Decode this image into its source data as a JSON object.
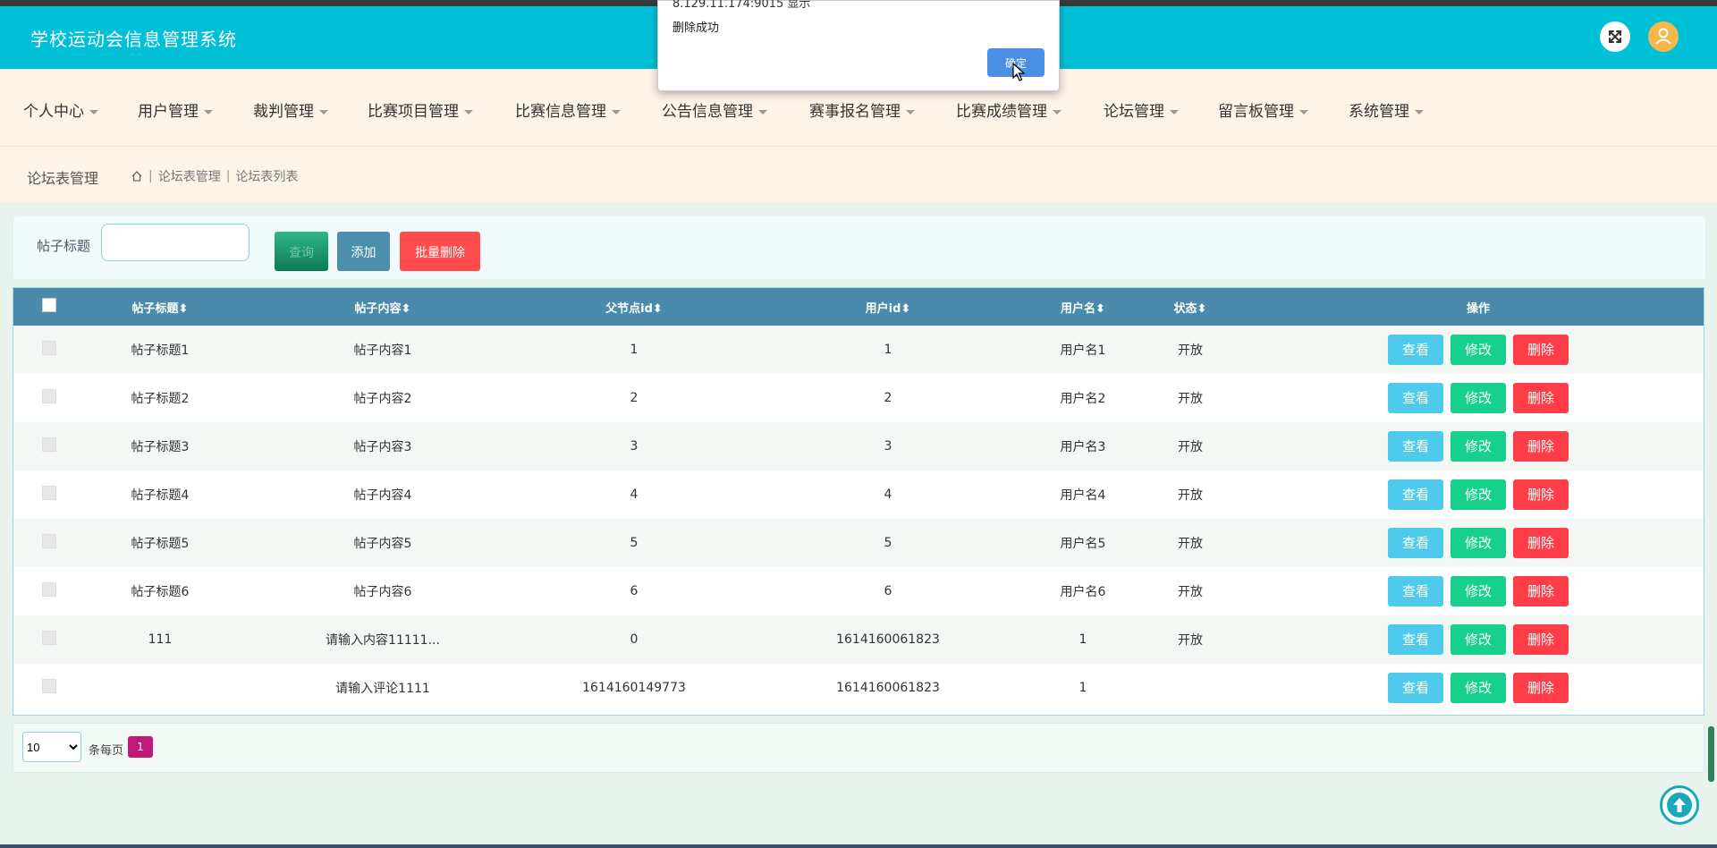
{
  "header": {
    "title": "学校运动会信息管理系统"
  },
  "nav": {
    "items": [
      "个人中心",
      "用户管理",
      "裁判管理",
      "比赛项目管理",
      "比赛信息管理",
      "公告信息管理",
      "赛事报名管理",
      "比赛成绩管理",
      "论坛管理",
      "留言板管理",
      "系统管理"
    ]
  },
  "breadcrumb": {
    "page": "论坛表管理",
    "level1": "论坛表管理",
    "level2": "论坛表列表"
  },
  "search": {
    "label": "帖子标题",
    "value": "",
    "search_btn": "查询",
    "add_btn": "添加",
    "batch_delete_btn": "批量删除"
  },
  "table": {
    "headers": [
      "帖子标题",
      "帖子内容",
      "父节点id",
      "用户id",
      "用户名",
      "状态",
      "操作"
    ],
    "actions": {
      "view": "查看",
      "edit": "修改",
      "delete": "删除"
    },
    "rows": [
      [
        "帖子标题1",
        "帖子内容1",
        "1",
        "1",
        "用户名1",
        "开放"
      ],
      [
        "帖子标题2",
        "帖子内容2",
        "2",
        "2",
        "用户名2",
        "开放"
      ],
      [
        "帖子标题3",
        "帖子内容3",
        "3",
        "3",
        "用户名3",
        "开放"
      ],
      [
        "帖子标题4",
        "帖子内容4",
        "4",
        "4",
        "用户名4",
        "开放"
      ],
      [
        "帖子标题5",
        "帖子内容5",
        "5",
        "5",
        "用户名5",
        "开放"
      ],
      [
        "帖子标题6",
        "帖子内容6",
        "6",
        "6",
        "用户名6",
        "开放"
      ],
      [
        "111",
        "请输入内容11111...",
        "0",
        "1614160061823",
        "1",
        "开放"
      ],
      [
        "",
        "请输入评论1111",
        "1614160149773",
        "1614160061823",
        "1",
        ""
      ]
    ]
  },
  "pagination": {
    "page_size": "10",
    "per_page_label": "条每页",
    "current_page": "1"
  },
  "dialog": {
    "origin": "8.129.11.174:9015 显示",
    "message": "删除成功",
    "ok": "确定"
  },
  "sort_arrow": "⬍",
  "colors": {
    "header": "#00c0d8",
    "table_header": "#4a8aab",
    "view": "#4ecbec",
    "edit": "#16d08c",
    "delete": "#ff3d48",
    "page": "#c2187a"
  }
}
